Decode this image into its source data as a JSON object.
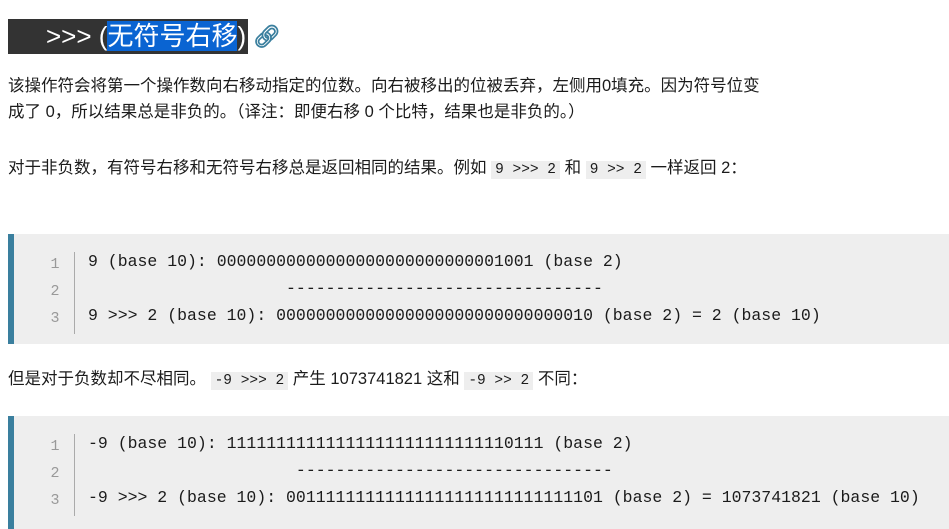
{
  "heading": {
    "prefix": ">>> (",
    "selected": "无符号右移",
    "suffix": ")",
    "link_icon": "link-icon"
  },
  "para1": "该操作符会将第一个操作数向右移动指定的位数。向右被移出的位被丢弃，左侧用0填充。因为符号位变成了 0，所以结果总是非负的。（译注：即便右移 0 个比特，结果也是非负的。）",
  "para2": {
    "t1": "对于非负数，有符号右移和无符号右移总是返回相同的结果。例如 ",
    "c1": "9 >>> 2",
    "t2": " 和 ",
    "c2": "9 >> 2",
    "t3": " 一样返回 2："
  },
  "code1": {
    "numbers": [
      "1",
      "2",
      "3"
    ],
    "lines": [
      "9 (base 10): 00000000000000000000000000001001 (base 2)",
      "                    --------------------------------",
      "9 >>> 2 (base 10): 00000000000000000000000000000010 (base 2) = 2 (base 10)"
    ]
  },
  "para3": {
    "t1": "但是对于负数却不尽相同。 ",
    "c1": "-9 >>> 2",
    "t2": " 产生 1073741821 这和 ",
    "c2": "-9 >> 2",
    "t3": " 不同："
  },
  "code2": {
    "numbers": [
      "1",
      "2",
      "3"
    ],
    "lines": [
      "-9 (base 10): 11111111111111111111111111110111 (base 2)",
      "                     --------------------------------",
      "-9 >>> 2 (base 10): 00111111111111111111111111111101 (base 2) = 1073741821 (base 10)"
    ]
  },
  "colors": {
    "accent": "#3a7f9e",
    "selection": "#0a64d2",
    "heading_bg": "#333333",
    "code_bg": "#eeeeee"
  }
}
